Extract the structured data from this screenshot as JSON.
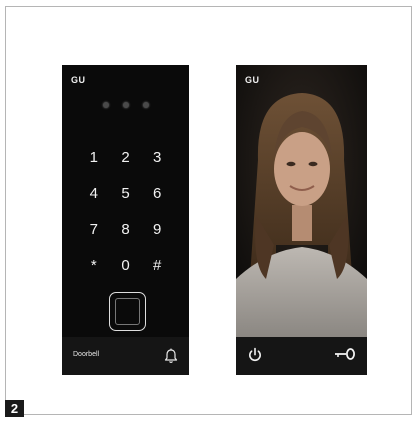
{
  "figure": {
    "number": "2"
  },
  "keypad_panel": {
    "logo": "GU",
    "keys": [
      "1",
      "2",
      "3",
      "4",
      "5",
      "6",
      "7",
      "8",
      "9",
      "*",
      "0",
      "#"
    ],
    "doorbell_label": "Doorbell"
  },
  "video_panel": {
    "logo": "GU"
  },
  "colors": {
    "panel": "#0a0a0a",
    "bar": "#151515",
    "text": "#f2f2f2"
  }
}
